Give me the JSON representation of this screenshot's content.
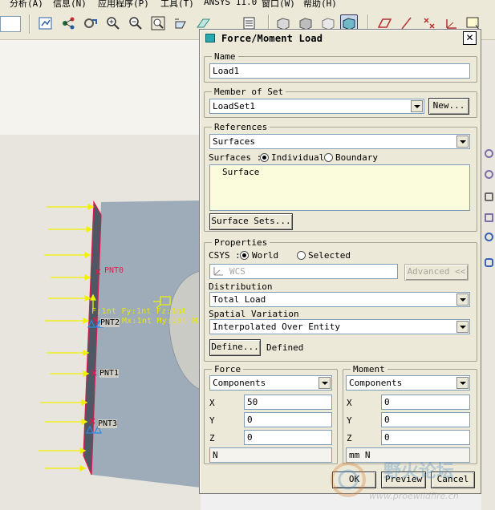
{
  "menu": {
    "items": [
      "分析(A)",
      "信息(N)",
      "应用程序(P)",
      "工具(T)",
      "ANSYS 11.0",
      "窗口(W)",
      "帮助(H)"
    ]
  },
  "toolbar": {
    "icons": [
      "analysis-icon",
      "datum-axis-icon",
      "regenerate-icon",
      "zoom-in-icon",
      "zoom-out-icon",
      "refit-icon",
      "annotation-icon",
      "plane-icon",
      "layer-icon",
      "view-icon",
      "shade-icon",
      "hidden-icon",
      "wireframe-icon",
      "datum-plane-icon",
      "sketch-icon",
      "csys-icon",
      "point-icon"
    ]
  },
  "viewport": {
    "labels": {
      "pnt0": "PNT0",
      "pnt1": "PNT1",
      "pnt2": "PNT2",
      "pnt3": "PNT3",
      "force_line": "F:1nt Fy:1nt Fz:1nt",
      "moment_line": "Mx:1nt My:1nt Mz:1nt"
    }
  },
  "dialog": {
    "title": "Force/Moment Load",
    "name": {
      "legend": "Name",
      "value": "Load1"
    },
    "member_of_set": {
      "legend": "Member of Set",
      "value": "LoadSet1",
      "new_button": "New..."
    },
    "references": {
      "legend": "References",
      "type_value": "Surfaces",
      "mode_label": "Surfaces :",
      "individual": "Individual",
      "boundary": "Boundary",
      "collector_item": "Surface",
      "surface_sets_button": "Surface Sets..."
    },
    "properties": {
      "legend": "Properties",
      "csys_label": "CSYS :",
      "world": "World",
      "selected": "Selected",
      "csys_value": "WCS",
      "advanced_button": "Advanced <<",
      "distribution_label": "Distribution",
      "distribution_value": "Total Load",
      "spatial_label": "Spatial Variation",
      "spatial_value": "Interpolated Over Entity",
      "define_button": "Define...",
      "defined_text": "Defined"
    },
    "force": {
      "legend": "Force",
      "mode": "Components",
      "x_label": "X",
      "x": "50",
      "y_label": "Y",
      "y": "0",
      "z_label": "Z",
      "z": "0",
      "units": "N"
    },
    "moment": {
      "legend": "Moment",
      "mode": "Components",
      "x_label": "X",
      "x": "0",
      "y_label": "Y",
      "y": "0",
      "z_label": "Z",
      "z": "0",
      "units": "mm N"
    },
    "buttons": {
      "ok": "OK",
      "preview": "Preview",
      "cancel": "Cancel"
    }
  },
  "watermark": {
    "text": "野火论坛",
    "url": "www.proewildfire.cn"
  },
  "colors": {
    "dialog_bg": "#ece9d8",
    "collector_bg": "#fbfcdc",
    "model_blue": "#9eacba",
    "force_arrow": "#f2f200",
    "edge_red": "#e02050"
  }
}
